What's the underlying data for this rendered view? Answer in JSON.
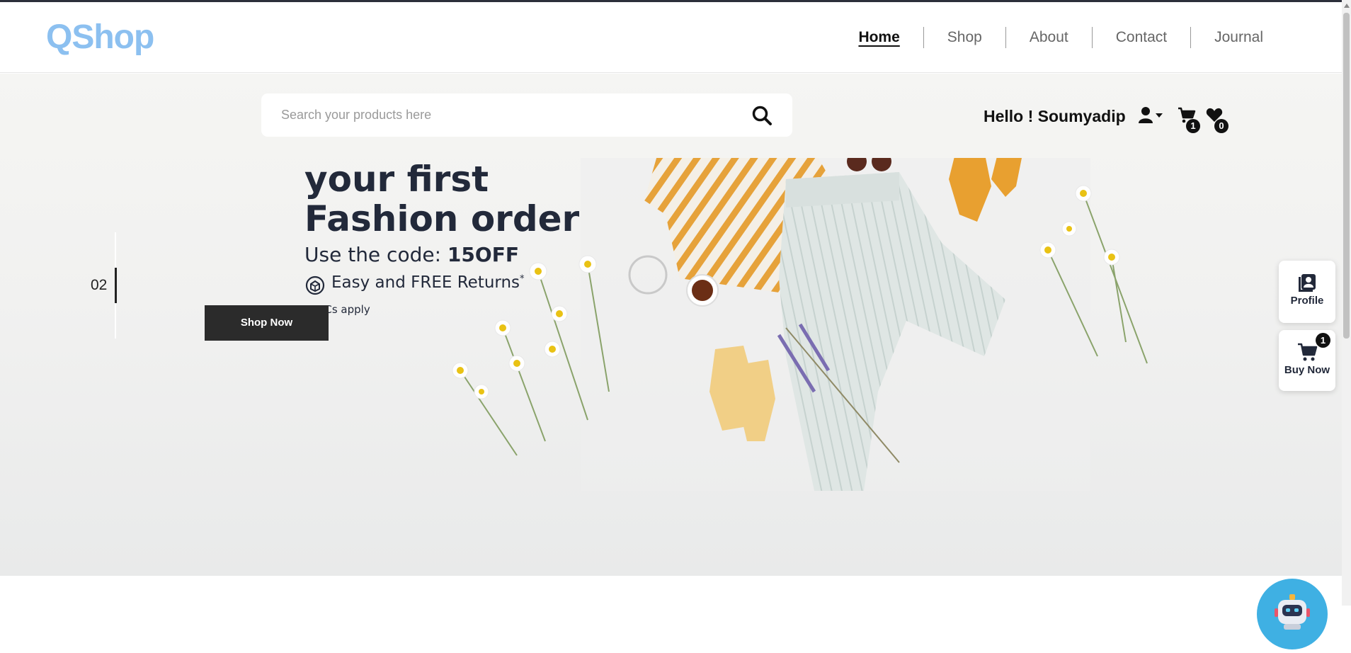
{
  "brand": {
    "logo": "QShop",
    "color": "#8cc0f0"
  },
  "nav": {
    "items": [
      {
        "label": "Home",
        "active": true
      },
      {
        "label": "Shop"
      },
      {
        "label": "About"
      },
      {
        "label": "Contact"
      },
      {
        "label": "Journal"
      }
    ]
  },
  "search": {
    "placeholder": "Search your products here",
    "icon": "search-icon"
  },
  "user": {
    "greeting": "Hello ! Soumyadip",
    "cart_count": "1",
    "wishlist_count": "0"
  },
  "hero": {
    "line1": "your first",
    "line2": "Fashion order",
    "code_prefix": "Use the code: ",
    "code": "15OFF",
    "returns": "Easy and FREE Returns",
    "returns_mark": "*",
    "tnc": "*T&Cs apply",
    "slide_number": "02",
    "cta": "Shop Now"
  },
  "side_panel": {
    "profile": "Profile",
    "buy_now": "Buy Now",
    "buy_count": "1"
  }
}
